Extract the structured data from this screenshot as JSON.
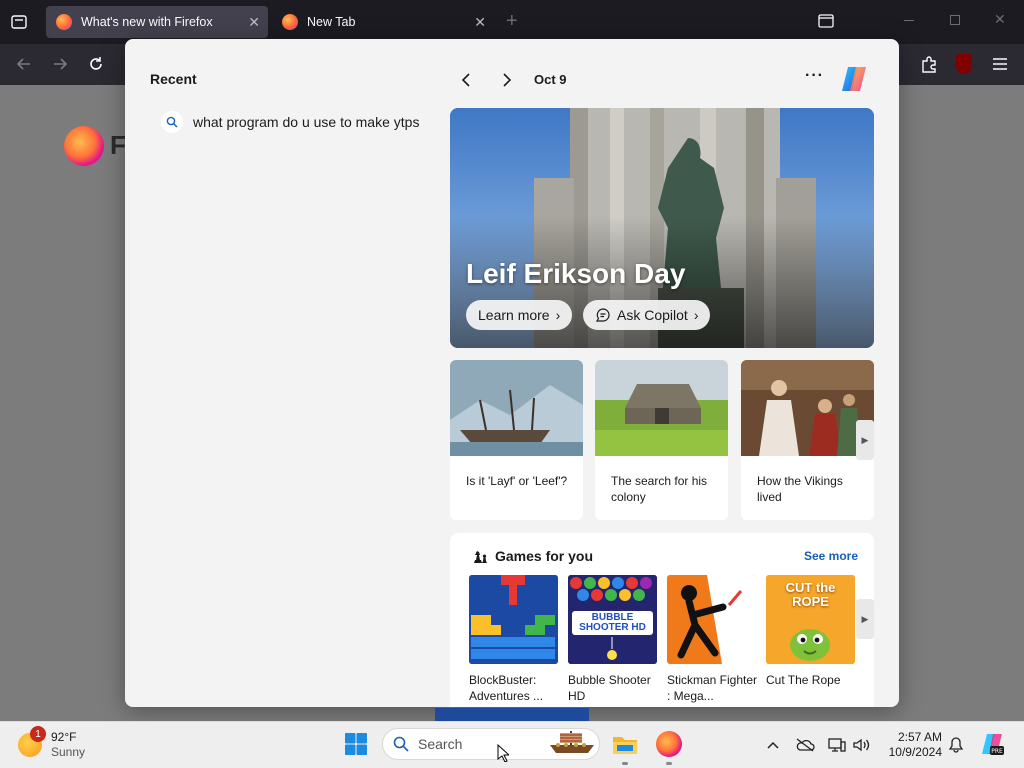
{
  "browser": {
    "tabs": [
      {
        "label": "What's new with Firefox",
        "active": true
      },
      {
        "label": "New Tab",
        "active": false
      }
    ],
    "new_tab_symbol": "+",
    "logo_text": "F"
  },
  "widgets": {
    "recent": {
      "title": "Recent",
      "items": [
        "what program do u use to make ytps"
      ]
    },
    "header": {
      "date": "Oct 9",
      "more_label": "···"
    },
    "hero": {
      "title": "Leif Erikson Day",
      "learn_more": "Learn more",
      "ask_copilot": "Ask Copilot"
    },
    "stories": [
      {
        "title": "Is it 'Layf' or 'Leef'?"
      },
      {
        "title": "The search for his colony"
      },
      {
        "title": "How the Vikings lived"
      }
    ],
    "games": {
      "title": "Games for you",
      "see_more": "See more",
      "items": [
        {
          "name": "BlockBuster: Adventures ...",
          "thumb_text": ""
        },
        {
          "name": "Bubble Shooter HD",
          "thumb_text": "BUBBLE SHOOTER HD"
        },
        {
          "name": "Stickman Fighter : Mega...",
          "thumb_text": ""
        },
        {
          "name": "Cut The Rope",
          "thumb_text": "CUT the ROPE"
        }
      ]
    }
  },
  "taskbar": {
    "weather": {
      "temp": "92°F",
      "condition": "Sunny",
      "badge": "1"
    },
    "search_placeholder": "Search",
    "clock": {
      "time": "2:57 AM",
      "date": "10/9/2024"
    }
  },
  "colors": {
    "accent_blue": "#1a5fb4",
    "taskbar_bg": "#eeeeee",
    "panel_bg": "#f3f3f3"
  }
}
